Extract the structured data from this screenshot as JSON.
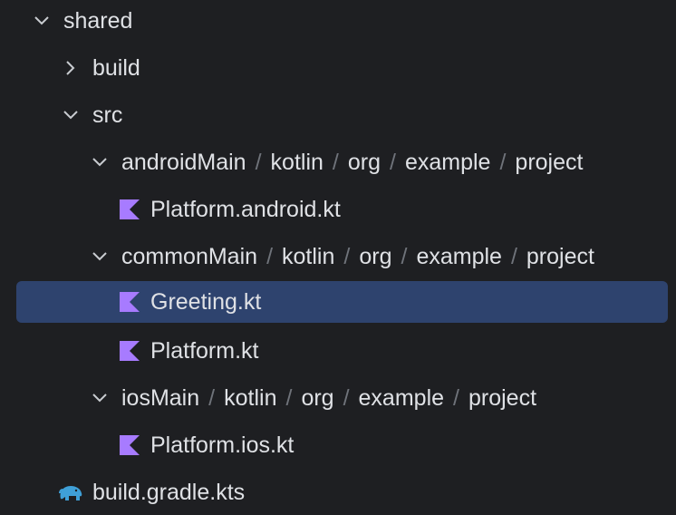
{
  "tree": {
    "nodes": [
      {
        "id": "shared",
        "label": "shared",
        "expanded": true,
        "icon": "chevron-down-icon"
      },
      {
        "id": "build",
        "label": "build",
        "expanded": false,
        "icon": "chevron-right-icon"
      },
      {
        "id": "src",
        "label": "src",
        "expanded": true,
        "icon": "chevron-down-icon"
      },
      {
        "id": "androidMain",
        "path": [
          "androidMain",
          "kotlin",
          "org",
          "example",
          "project"
        ],
        "expanded": true,
        "icon": "chevron-down-icon"
      },
      {
        "id": "platform-android",
        "label": "Platform.android.kt",
        "icon": "kotlin-file-icon"
      },
      {
        "id": "commonMain",
        "path": [
          "commonMain",
          "kotlin",
          "org",
          "example",
          "project"
        ],
        "expanded": true,
        "icon": "chevron-down-icon"
      },
      {
        "id": "greeting",
        "label": "Greeting.kt",
        "icon": "kotlin-file-icon",
        "selected": true
      },
      {
        "id": "platform",
        "label": "Platform.kt",
        "icon": "kotlin-file-icon"
      },
      {
        "id": "iosMain",
        "path": [
          "iosMain",
          "kotlin",
          "org",
          "example",
          "project"
        ],
        "expanded": true,
        "icon": "chevron-down-icon"
      },
      {
        "id": "platform-ios",
        "label": "Platform.ios.kt",
        "icon": "kotlin-file-icon"
      },
      {
        "id": "build-gradle",
        "label": "build.gradle.kts",
        "icon": "gradle-elephant-icon"
      }
    ],
    "path_separator": "/",
    "colors": {
      "background": "#1e1f22",
      "selection": "#2e436e",
      "text": "#dfe1e5",
      "separator": "#6f737a",
      "kotlin_icon": "#a77bff",
      "gradle_icon": "#3fa0d8"
    }
  }
}
